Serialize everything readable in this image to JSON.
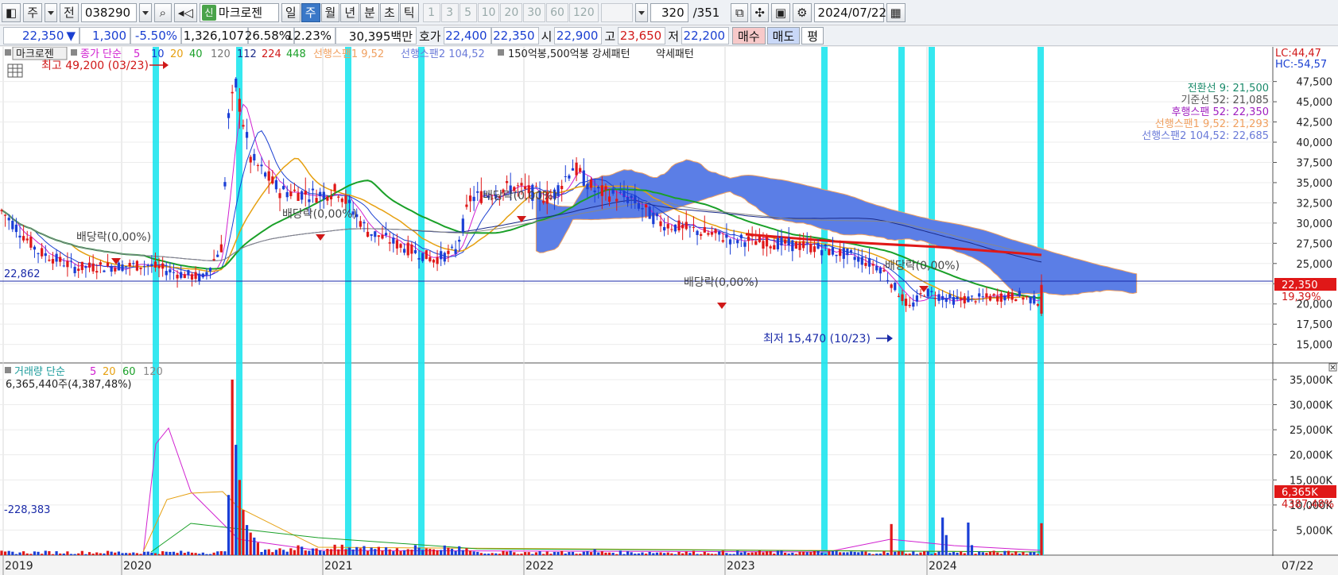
{
  "toolbar": {
    "period_unit": "주",
    "prev_label": "전",
    "stock_code": "038290",
    "new_badge": "신",
    "stock_name": "마크로젠",
    "period_tabs": [
      "일",
      "주",
      "월",
      "년",
      "분",
      "초",
      "틱"
    ],
    "active_period": "주",
    "interval_buttons": [
      "1",
      "3",
      "5",
      "10",
      "20",
      "30",
      "60",
      "120"
    ],
    "count_value": "320",
    "count_total": "/351",
    "date": "2024/07/22"
  },
  "quote": {
    "price": "22,350",
    "change": "1,300",
    "change_pct": "-5.50%",
    "volume": "1,326,107",
    "ratio1": "26.58%",
    "ratio2": "12.23%",
    "trade_amount": "30,395백만",
    "hoga_label": "호가",
    "ask": "22,400",
    "bid": "22,350",
    "open_label": "시",
    "open": "22,900",
    "high_label": "고",
    "high": "23,650",
    "low_label": "저",
    "low": "22,200",
    "buy_label": "매수",
    "sell_label": "매도",
    "eval_label": "평"
  },
  "legend": {
    "name": "마크로젠",
    "close_label": "종가 단순",
    "ma": [
      "5",
      "10",
      "20",
      "40",
      "120",
      "112",
      "224",
      "448"
    ],
    "span1": "선행스팬1 9,52",
    "span2": "선행스팬2 104,52",
    "pattern": "150억봉,500억봉 강세패턴",
    "weak": "약세패턴"
  },
  "annotations": {
    "high": "최고 49,200 (03/23)",
    "low": "최저 15,470 (10/23)",
    "dividend": "배당락(0,00%)",
    "left_value": "22,862",
    "lc": "LC:44,47",
    "hc": "HC:-54,57",
    "current_price": "22,350",
    "current_pct": "19,39%"
  },
  "ichimoku_legend": [
    {
      "label": "전환선 9: 21,500",
      "color": "#1a8a6a"
    },
    {
      "label": "기준선 52: 21,085",
      "color": "#555555"
    },
    {
      "label": "후행스팬 52: 22,350",
      "color": "#a020c0"
    },
    {
      "label": "선행스팬1 9,52: 21,293",
      "color": "#f0a060"
    },
    {
      "label": "선행스팬2 104,52: 22,685",
      "color": "#6a7ad8"
    }
  ],
  "volume_legend": {
    "label": "거래량 단순",
    "ma": [
      "5",
      "20",
      "60",
      "120"
    ],
    "value": "6,365,440주(4,387,48%)",
    "left_value": "-228,383",
    "current": "6,365K",
    "current_pct": "4387,48%"
  },
  "x_labels": [
    "2019",
    "2020",
    "2021",
    "2022",
    "2023",
    "2024",
    "07/22"
  ],
  "chart_data": {
    "type": "candlestick",
    "x_axis": [
      "2019",
      "2020",
      "2021",
      "2022",
      "2023",
      "2024"
    ],
    "price_ticks": [
      "47,500",
      "45,000",
      "42,500",
      "40,000",
      "37,500",
      "35,000",
      "32,500",
      "30,000",
      "27,500",
      "25,000",
      "22,500",
      "20,000",
      "17,500",
      "15,000"
    ],
    "volume_ticks": [
      "35,000K",
      "30,000K",
      "25,000K",
      "20,000K",
      "15,000K",
      "10,000K",
      "5,000K"
    ],
    "price_ylim": [
      13000,
      51000
    ],
    "volume_ylim": [
      0,
      38000
    ],
    "current_price": 22350,
    "period_high": 49200,
    "period_low": 15470,
    "colors": {
      "up": "#e01818",
      "down": "#1b3fd6",
      "cloud": "#5b7ee6",
      "signal": "#1fe6ee",
      "ma10": "#e6a010",
      "ma20": "#1aa028",
      "ma5": "#d020d0"
    }
  }
}
